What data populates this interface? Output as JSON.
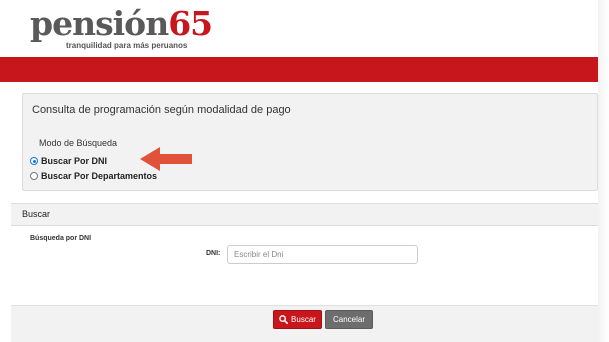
{
  "header": {
    "logo_text": "pensión",
    "logo_number": "65",
    "tagline": "tranquilidad para más peruanos"
  },
  "consulta": {
    "title": "Consulta de programación según modalidad de pago",
    "modo_label": "Modo de Búsqueda",
    "options": [
      {
        "label": "Buscar Por DNI",
        "selected": true
      },
      {
        "label": "Buscar Por Departamentos",
        "selected": false
      }
    ]
  },
  "buscar": {
    "section_title": "Buscar",
    "subsection_label": "Búsqueda por DNI",
    "dni_label": "DNI:",
    "dni_value": "",
    "dni_placeholder": "Escribir el Dni"
  },
  "actions": {
    "search_label": "Buscar",
    "cancel_label": "Cancelar"
  },
  "colors": {
    "brand_red": "#c8161d",
    "arrow": "#e0523a",
    "cancel_gray": "#6d6d6d",
    "panel_bg": "#f2f2f2"
  },
  "icons": {
    "search_button_icon": "search-icon",
    "annotation": "arrow-left-icon"
  }
}
